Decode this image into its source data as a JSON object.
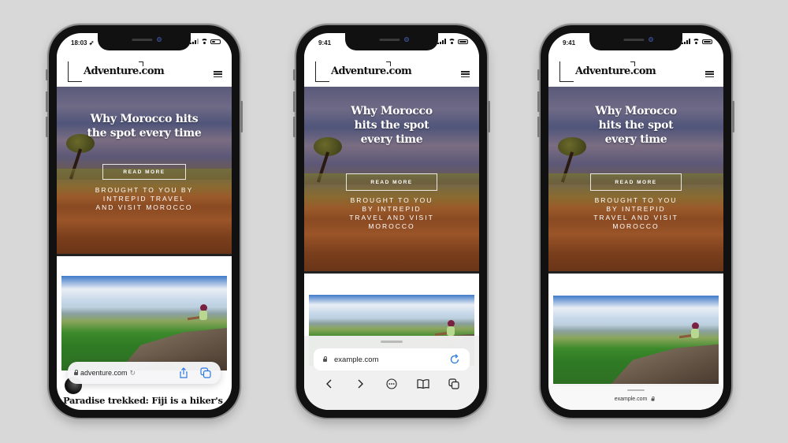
{
  "background_color": "#d8d8d8",
  "phones": [
    {
      "status": {
        "time": "18:03",
        "location_arrow": true
      },
      "header": {
        "logo": "Adventure.com",
        "menu_icon": "hamburger-icon"
      },
      "hero": {
        "title_lines": [
          "Why Morocco hits",
          "the spot every time"
        ],
        "cta": "READ MORE",
        "sponsor_lines": [
          "BROUGHT TO YOU BY",
          "INTREPID TRAVEL",
          "AND VISIT MOROCCO"
        ]
      },
      "next_article": {
        "title": "Paradise trekked: Fiji is a hiker's"
      },
      "safari": {
        "style": "floating-compact",
        "address": "adventure.com",
        "actions": [
          "share-icon",
          "tabs-icon"
        ]
      }
    },
    {
      "status": {
        "time": "9:41"
      },
      "header": {
        "logo": "Adventure.com",
        "menu_icon": "hamburger-icon"
      },
      "hero": {
        "title_lines": [
          "Why Morocco",
          "hits the spot",
          "every time"
        ],
        "cta": "READ MORE",
        "sponsor_lines": [
          "BROUGHT TO YOU",
          "BY INTREPID",
          "TRAVEL AND VISIT",
          "MOROCCO"
        ]
      },
      "safari": {
        "style": "expanded-bottom",
        "address": "example.com",
        "toolbar": [
          "back-icon",
          "forward-icon",
          "more-icon",
          "bookmarks-icon",
          "tabs-icon"
        ]
      }
    },
    {
      "status": {
        "time": "9:41"
      },
      "header": {
        "logo": "Adventure.com",
        "menu_icon": "hamburger-icon"
      },
      "hero": {
        "title_lines": [
          "Why Morocco",
          "hits the spot",
          "every time"
        ],
        "cta": "READ MORE",
        "sponsor_lines": [
          "BROUGHT TO YOU",
          "BY INTREPID",
          "TRAVEL AND VISIT",
          "MOROCCO"
        ]
      },
      "safari": {
        "style": "minimized",
        "address": "example.com"
      }
    }
  ]
}
